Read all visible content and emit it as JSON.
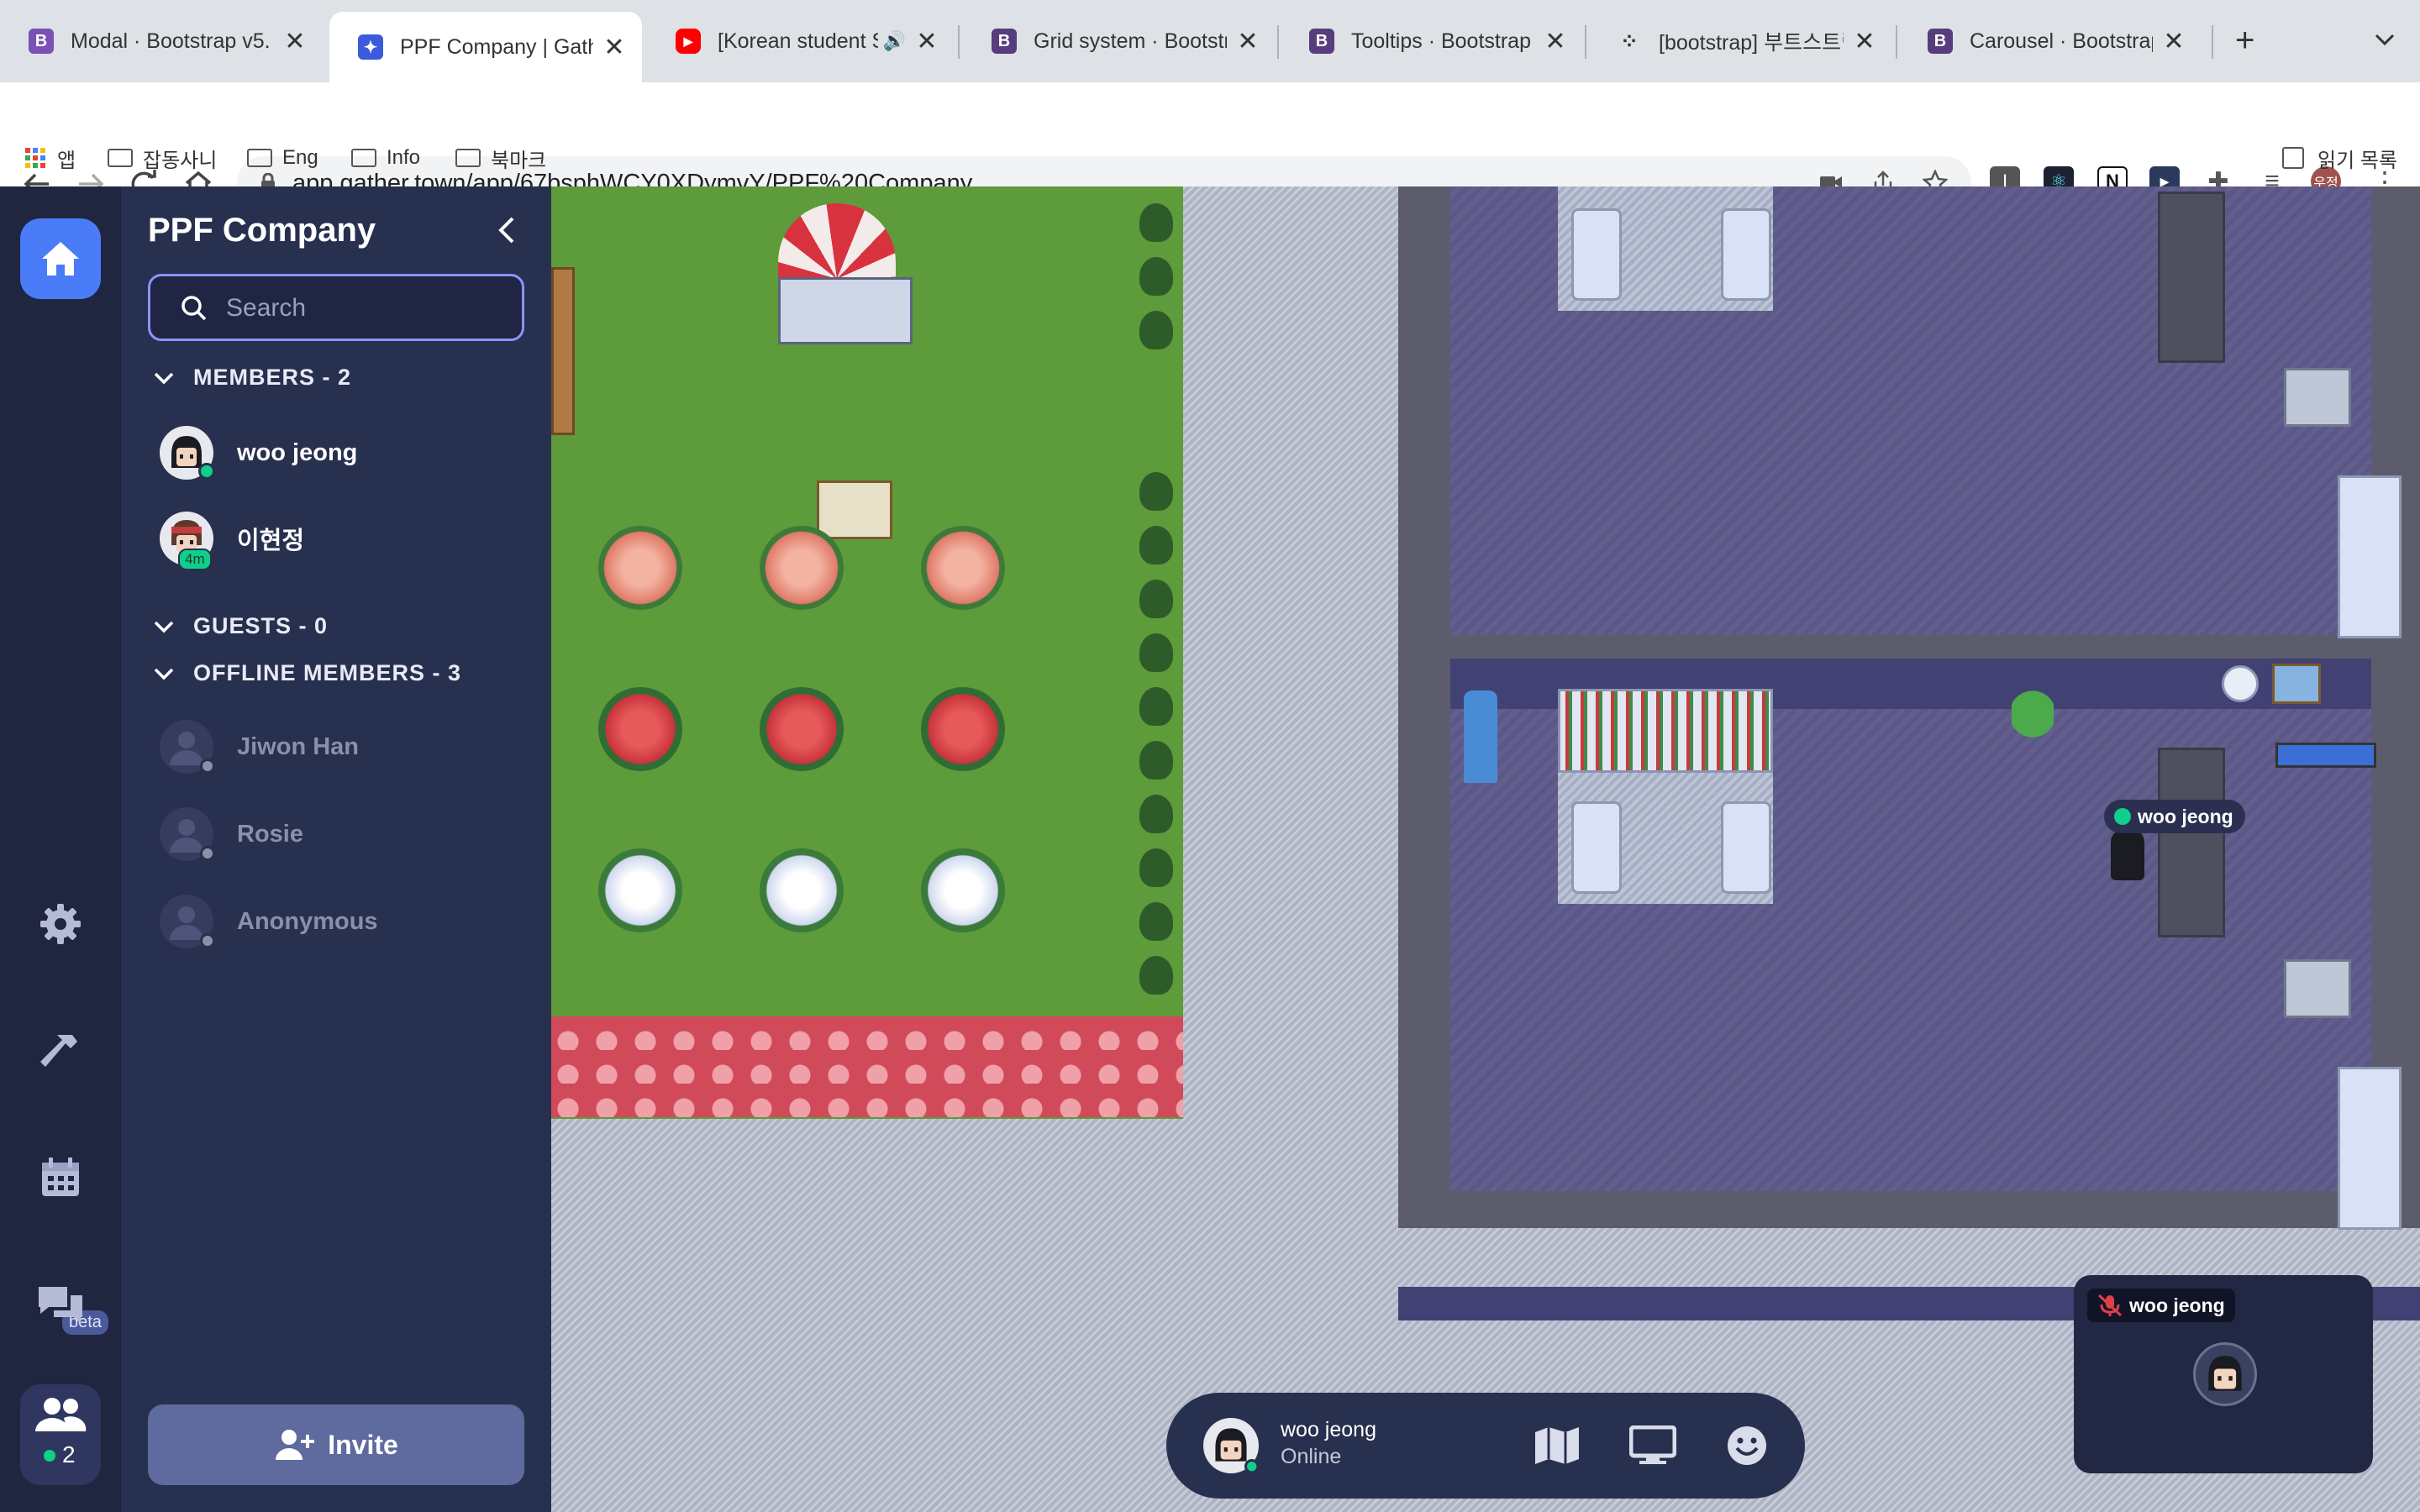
{
  "tabs": [
    {
      "title": "Modal · Bootstrap v5.",
      "favicon": "bootstrap-icon",
      "color": "#7952b3",
      "letter": "B"
    },
    {
      "title": "PPF Company | Gathe",
      "favicon": "gather-icon",
      "color": "#3b5bdb",
      "letter": "G"
    },
    {
      "title": "[Korean student S",
      "favicon": "youtube-icon",
      "color": "#ff0000",
      "letter": "▶"
    },
    {
      "title": "Grid system · Bootstra",
      "favicon": "bootstrap-icon",
      "color": "#563d7c",
      "letter": "B"
    },
    {
      "title": "Tooltips · Bootstrap",
      "favicon": "bootstrap-icon",
      "color": "#563d7c",
      "letter": "B"
    },
    {
      "title": "[bootstrap] 부트스트랩",
      "favicon": "dots-icon",
      "color": "#333333",
      "letter": "⁘"
    },
    {
      "title": "Carousel · Bootstrap",
      "favicon": "bootstrap-icon",
      "color": "#563d7c",
      "letter": "B"
    }
  ],
  "browser": {
    "url": "app.gather.town/app/67bsphWCY0XDymvY/PPF%20Company",
    "new_tab": "+",
    "profile": "우정"
  },
  "bookmarks": [
    {
      "label": "앱",
      "type": "apps"
    },
    {
      "label": "잡동사니",
      "type": "folder"
    },
    {
      "label": "Eng",
      "type": "folder"
    },
    {
      "label": "Info",
      "type": "folder"
    },
    {
      "label": "북마크",
      "type": "folder"
    }
  ],
  "reading_list": "읽기 목록",
  "panel": {
    "title": "PPF Company",
    "search_placeholder": "Search",
    "members_header": "MEMBERS - 2",
    "guests_header": "GUESTS - 0",
    "offline_header": "OFFLINE MEMBERS - 3",
    "members": [
      {
        "name": "woo jeong",
        "status_color": "#0fcf8a"
      },
      {
        "name": "이현정",
        "status_badge": "4m",
        "status_color": "#0fcf8a"
      }
    ],
    "offline_members": [
      "Jiwon Han",
      "Rosie",
      "Anonymous"
    ],
    "invite_label": "Invite"
  },
  "rail": {
    "beta_badge": "beta",
    "participants_count": "2"
  },
  "map": {
    "nametag": "woo jeong"
  },
  "bottom_bar": {
    "name": "woo jeong",
    "status": "Online"
  },
  "video": {
    "name": "woo jeong"
  },
  "colors": {
    "rail_bg": "#202540",
    "panel_bg": "#28304f",
    "accent": "#4a7cf7",
    "invite_bg": "#5f6a9f",
    "online": "#0fcf8a"
  }
}
